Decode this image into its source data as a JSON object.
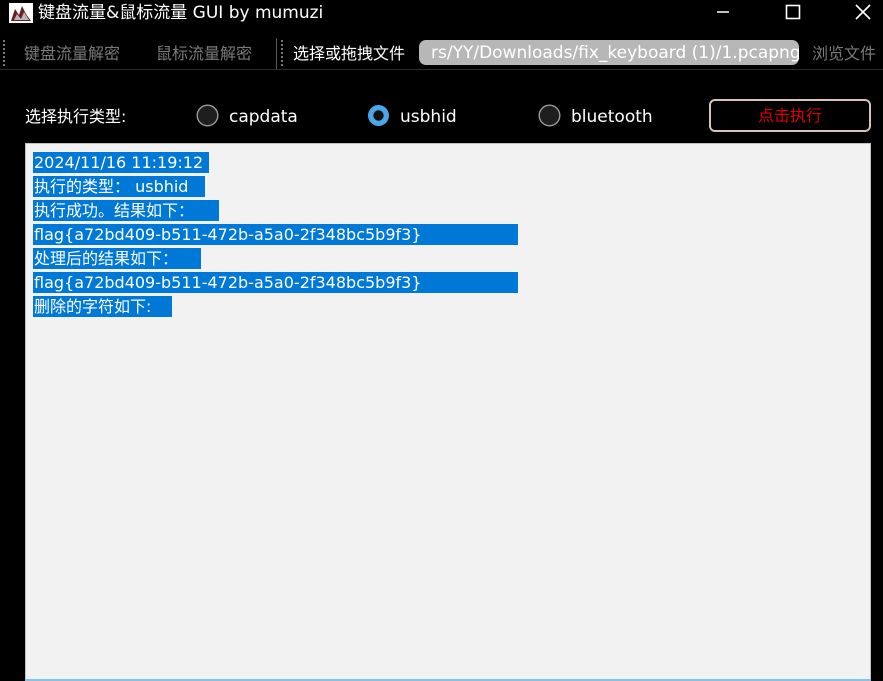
{
  "window": {
    "title": "键盘流量&鼠标流量 GUI by mumuzi"
  },
  "toolbar": {
    "tabs": [
      "键盘流量解密",
      "鼠标流量解密"
    ],
    "file_label": "选择或拖拽文件",
    "path_value": "rs/YY/Downloads/fix_keyboard (1)/1.pcapng",
    "browse_label": "浏览文件"
  },
  "options": {
    "type_label": "选择执行类型:",
    "radios": [
      {
        "label": "capdata",
        "selected": false
      },
      {
        "label": "usbhid",
        "selected": true
      },
      {
        "label": "bluetooth",
        "selected": false
      }
    ],
    "execute_label": "点击执行"
  },
  "output": {
    "lines": [
      "2024/11/16 11:19:12",
      "执行的类型： usbhid",
      "执行成功。结果如下：",
      "flag{a72bd409-b511-472b-a5a0-2f348bc5b9f3}",
      "处理后的结果如下：",
      "flag{a72bd409-b511-472b-a5a0-2f348bc5b9f3}",
      "删除的字符如下:"
    ]
  },
  "colors": {
    "accent": "#0078d7",
    "execute_text": "#e00000",
    "radio_selected": "#4aa8e8"
  },
  "icons": [
    "app-icon",
    "minimize-icon",
    "maximize-icon",
    "close-icon"
  ]
}
